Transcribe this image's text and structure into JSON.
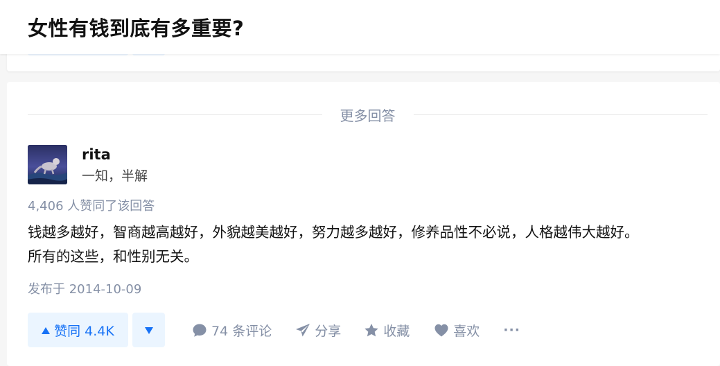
{
  "question": {
    "title": "女性有钱到底有多重要?"
  },
  "section": {
    "more_answers_label": "更多回答"
  },
  "answer": {
    "author_name": "rita",
    "author_headline": "一知，半解",
    "vote_summary": "4,406 人赞同了该回答",
    "paragraphs": [
      "钱越多越好，智商越高越好，外貌越美越好，努力越多越好，修养品性不必说，人格越伟大越好。",
      "所有的这些，和性别无关。"
    ],
    "post_time": "发布于 2014-10-09"
  },
  "actions": {
    "upvote_label": "赞同 4.4K",
    "comment_label": "74 条评论",
    "share_label": "分享",
    "favorite_label": "收藏",
    "like_label": "喜欢",
    "more_label": "···"
  },
  "icons": {
    "upvote": "triangle-up-icon",
    "downvote": "triangle-down-icon",
    "comment": "comment-bubble-icon",
    "share": "paper-plane-icon",
    "favorite": "star-icon",
    "like": "heart-icon",
    "more": "ellipsis-icon"
  },
  "colors": {
    "brand_blue": "#1772f6",
    "vote_bg": "#ebf5ff",
    "meta_gray": "#8590a6",
    "text": "#121212",
    "page_bg": "#f6f6f6"
  }
}
